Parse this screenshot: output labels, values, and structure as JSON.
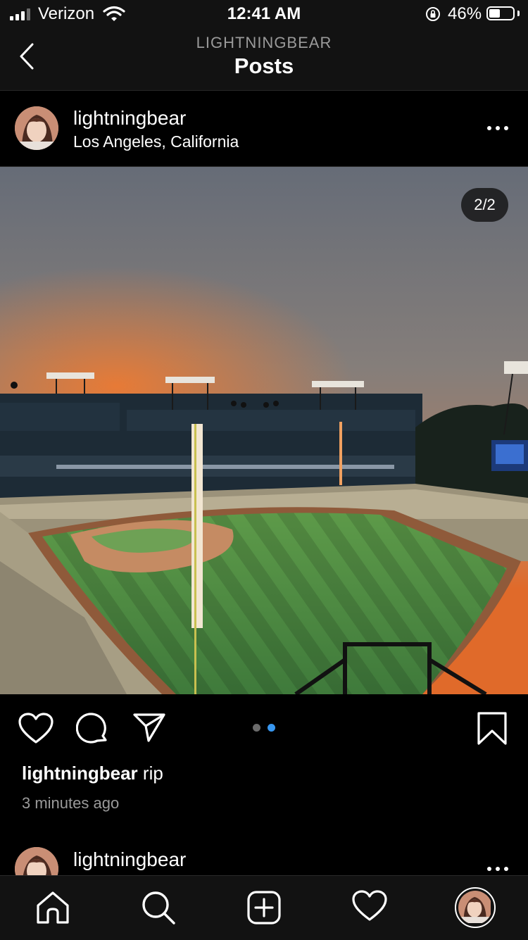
{
  "status_bar": {
    "carrier": "Verizon",
    "time": "12:41 AM",
    "battery_percent": "46%",
    "battery_level": 0.46,
    "signal_bars": 3,
    "icons": [
      "signal-icon",
      "wifi-icon",
      "orientation-lock-icon",
      "battery-icon"
    ]
  },
  "nav": {
    "subtitle": "LIGHTNINGBEAR",
    "title": "Posts",
    "back_icon": "chevron-left-icon"
  },
  "post": {
    "username": "lightningbear",
    "location": "Los Angeles, California",
    "media_counter": "2/2",
    "media_index": 2,
    "media_count": 2,
    "caption_user": "lightningbear",
    "caption_text": "rip",
    "timestamp": "3 minutes ago",
    "actions": [
      "heart-icon",
      "comment-icon",
      "share-icon",
      "bookmark-icon"
    ]
  },
  "next_post": {
    "username": "lightningbear"
  },
  "tab_bar": {
    "items": [
      "home-icon",
      "search-icon",
      "add-post-icon",
      "heart-icon",
      "profile-avatar"
    ]
  },
  "colors": {
    "background": "#000000",
    "bar_background": "#121212",
    "active_dot": "#3897f0",
    "inactive_dot": "#6b6b6b",
    "secondary_text": "#9a9a9a"
  }
}
